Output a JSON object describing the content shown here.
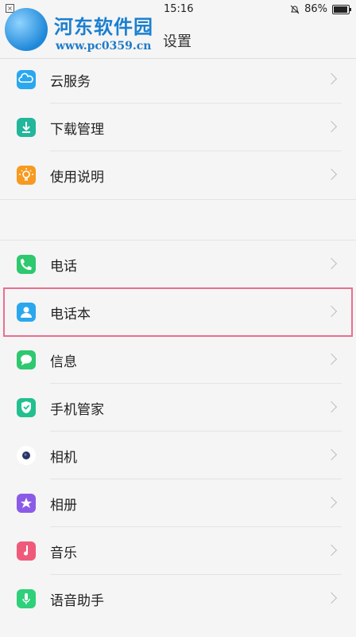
{
  "status_bar": {
    "time": "15:16",
    "battery": "86%",
    "battery_level": 0.86
  },
  "watermark": {
    "title": "河东软件园",
    "url": "www.pc0359.cn"
  },
  "header": {
    "title": "设置"
  },
  "group1": [
    {
      "label": "云服务",
      "icon": "cloud-icon",
      "color": "#2aa7ef"
    },
    {
      "label": "下载管理",
      "icon": "download-icon",
      "color": "#22b69b"
    },
    {
      "label": "使用说明",
      "icon": "lightbulb-icon",
      "color": "#f79a1f"
    }
  ],
  "group2": [
    {
      "label": "电话",
      "icon": "phone-icon",
      "color": "#2ec86f"
    },
    {
      "label": "电话本",
      "icon": "contacts-icon",
      "color": "#2aa7ef"
    },
    {
      "label": "信息",
      "icon": "message-icon",
      "color": "#2ec86f"
    },
    {
      "label": "手机管家",
      "icon": "shield-icon",
      "color": "#22c08f"
    },
    {
      "label": "相机",
      "icon": "camera-icon",
      "color": "#1b1f3a"
    },
    {
      "label": "相册",
      "icon": "gallery-icon",
      "color": "#8b5be8"
    },
    {
      "label": "音乐",
      "icon": "music-icon",
      "color": "#f05a7a"
    },
    {
      "label": "语音助手",
      "icon": "voice-assistant-icon",
      "color": "#2ed07a"
    }
  ]
}
